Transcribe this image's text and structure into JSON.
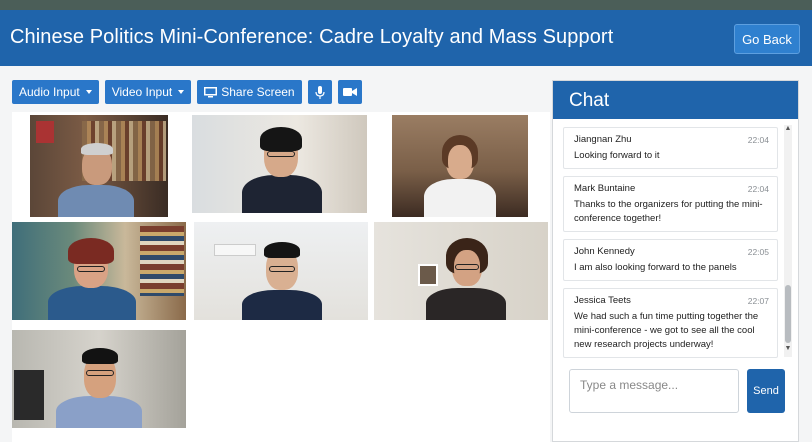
{
  "header": {
    "title": "Chinese Politics Mini-Conference: Cadre Loyalty and Mass Support",
    "back_label": "Go Back"
  },
  "toolbar": {
    "audio_label": "Audio Input",
    "video_label": "Video Input",
    "share_label": "Share Screen",
    "mic_icon": "microphone-icon",
    "camera_icon": "video-camera-icon"
  },
  "chat": {
    "title": "Chat",
    "messages": [
      {
        "name": "Jiangnan Zhu",
        "time": "22:04",
        "text": "Looking forward to it"
      },
      {
        "name": "Mark Buntaine",
        "time": "22:04",
        "text": "Thanks to the organizers for putting the mini-conference together!"
      },
      {
        "name": "John Kennedy",
        "time": "22:05",
        "text": "I am also looking forward to the panels"
      },
      {
        "name": "Jessica Teets",
        "time": "22:07",
        "text": "We had such a fun time putting together the mini-conference - we got to see all the cool new research projects underway!"
      }
    ],
    "input_placeholder": "Type a message...",
    "send_label": "Send"
  },
  "colors": {
    "brand": "#1f64ab",
    "button": "#2a77c9",
    "top_strip": "#4b5e58"
  }
}
